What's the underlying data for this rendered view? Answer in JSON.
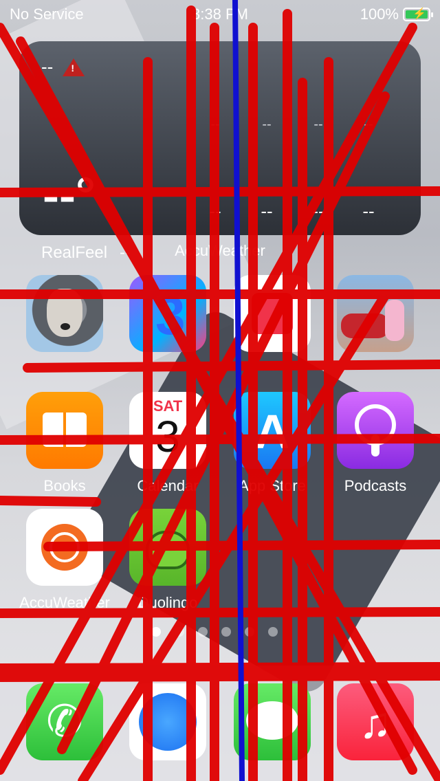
{
  "status_bar": {
    "carrier": "No Service",
    "time": "3:38 PM",
    "battery": "100%"
  },
  "widget": {
    "location": "--",
    "temperature": "--°",
    "realfeel_label": "RealFeel",
    "realfeel_value": "--",
    "forecast_top": [
      "--",
      "--",
      "--",
      "--"
    ],
    "forecast_bottom": [
      "--",
      "--",
      "--",
      "--"
    ],
    "app_label": "AccuWeather"
  },
  "apps": {
    "row1": [
      "",
      "",
      "",
      ""
    ],
    "row2": [
      "Books",
      "Calendar",
      "App Store",
      "Podcasts"
    ],
    "row3": [
      "AccuWeather",
      "Duolingo"
    ]
  },
  "calendar": {
    "day": "SAT",
    "date": "3"
  },
  "page_indicator": {
    "pages": 6,
    "active": 1
  },
  "dock": [
    "Phone",
    "Safari",
    "Messages",
    "Music"
  ],
  "colors": {
    "scribble_red": "#e00000",
    "scribble_blue": "#1010d0"
  }
}
